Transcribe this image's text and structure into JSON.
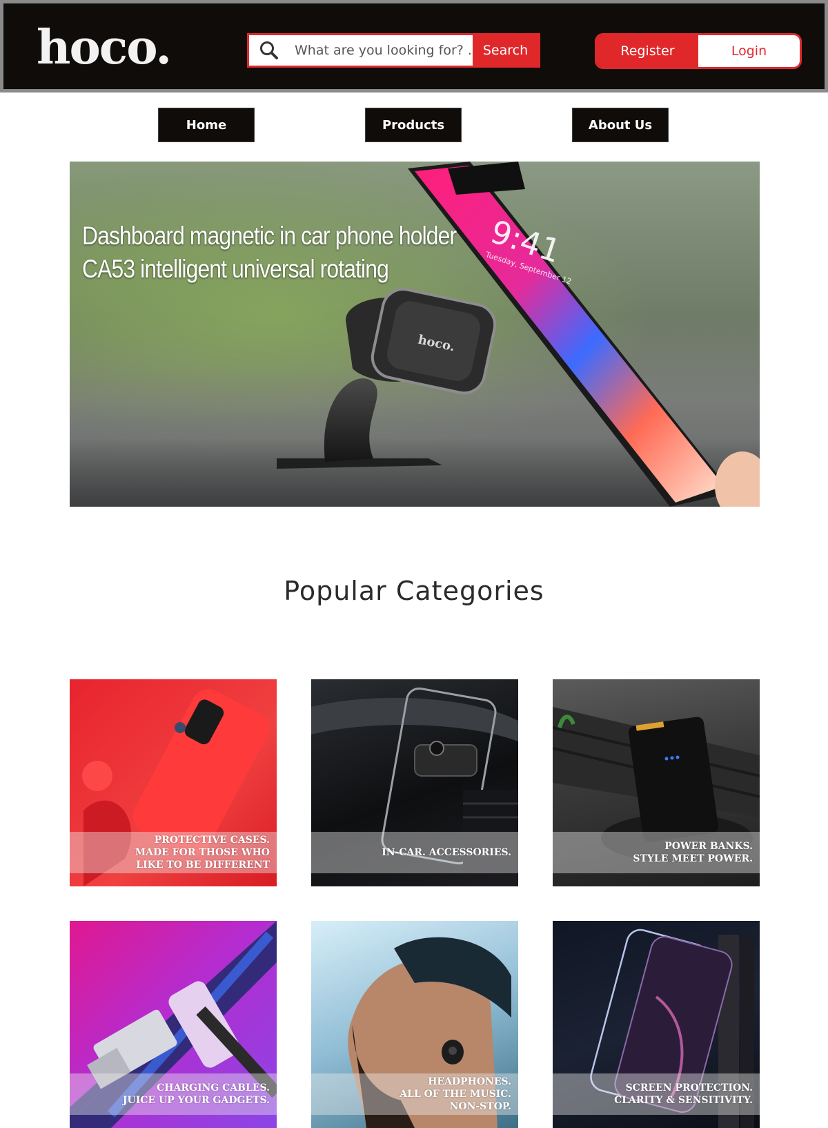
{
  "header": {
    "logo": "hoco.",
    "search": {
      "placeholder": "What are you looking for? ...",
      "button": "Search"
    },
    "register": "Register",
    "login": "Login"
  },
  "nav": {
    "items": [
      "Home",
      "Products",
      "About Us"
    ]
  },
  "hero": {
    "title_line1": "Dashboard magnetic in car phone holder",
    "title_line2": "CA53 intelligent universal rotating",
    "mount_logo": "hoco.",
    "phone_time": "9:41",
    "phone_date": "Tuesday, September 12"
  },
  "section_title": "Popular Categories",
  "categories": [
    {
      "lines": [
        "PROTECTIVE CASES.",
        "MADE FOR THOSE WHO",
        "LIKE TO BE DIFFERENT"
      ]
    },
    {
      "lines": [
        "IN-CAR. ACCESSORIES."
      ]
    },
    {
      "lines": [
        "POWER BANKS.",
        "STYLE MEET POWER."
      ]
    },
    {
      "lines": [
        "CHARGING CABLES.",
        "JUICE UP YOUR GADGETS."
      ]
    },
    {
      "lines": [
        "HEADPHONES.",
        "ALL OF THE MUSIC.",
        "NON-STOP."
      ]
    },
    {
      "lines": [
        "SCREEN PROTECTION.",
        "CLARITY & SENSITIVITY."
      ]
    }
  ],
  "colors": {
    "accent": "#e0282b",
    "header_bg": "#100c0a",
    "nav_bg": "#100c0a"
  },
  "icons": {
    "search": "magnifier-icon"
  }
}
